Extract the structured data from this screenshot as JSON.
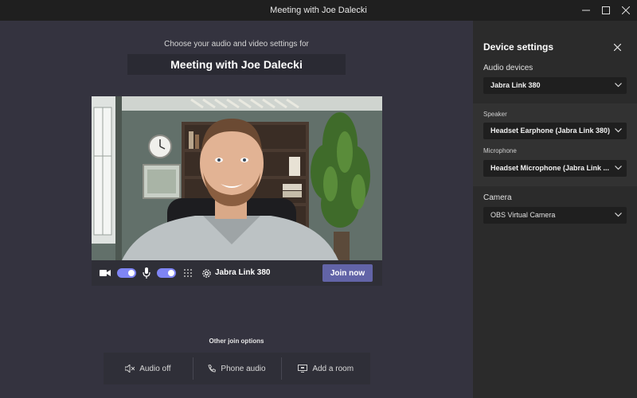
{
  "window": {
    "title": "Meeting with Joe Dalecki"
  },
  "lobby": {
    "subtitle": "Choose your audio and video settings for",
    "meeting_title": "Meeting with Joe Dalecki",
    "controls": {
      "camera_on": true,
      "mic_on": true,
      "device_label": "Jabra Link 380",
      "join_label": "Join now"
    },
    "other_join_label": "Other join options",
    "join_options": [
      {
        "label": "Audio off",
        "icon": "speaker-off-icon"
      },
      {
        "label": "Phone audio",
        "icon": "phone-icon"
      },
      {
        "label": "Add a room",
        "icon": "room-cast-icon"
      }
    ]
  },
  "device_settings": {
    "title": "Device settings",
    "audio_devices_label": "Audio devices",
    "audio_device_value": "Jabra Link 380",
    "speaker_label": "Speaker",
    "speaker_value": "Headset Earphone (Jabra Link 380)",
    "microphone_label": "Microphone",
    "microphone_value": "Headset Microphone (Jabra Link ...",
    "camera_label": "Camera",
    "camera_value": "OBS Virtual Camera"
  },
  "colors": {
    "accent": "#6264a7",
    "toggle_on": "#7f85f5",
    "lobby_bg": "#34333f",
    "panel_bg": "#2b2b2b"
  }
}
